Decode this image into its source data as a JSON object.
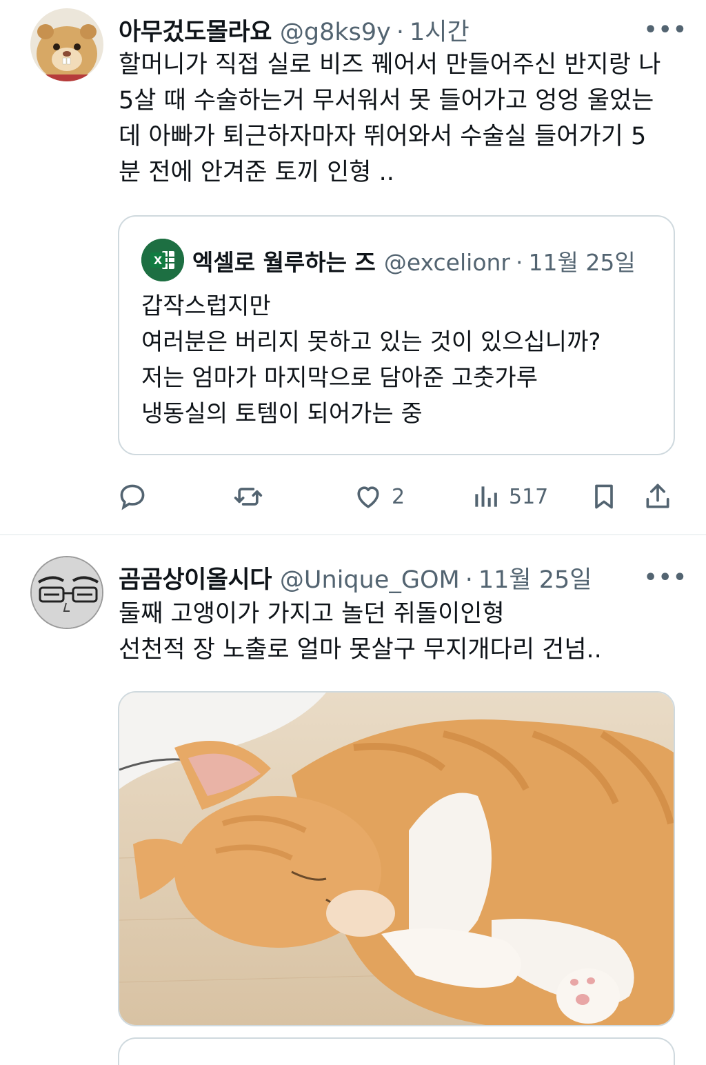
{
  "tweets": [
    {
      "name": "아무겄도몰라요",
      "handle": "@g8ks9y",
      "separator": "·",
      "time": "1시간",
      "more": "•••",
      "text_lines": [
        "할머니가 직접 실로 비즈 꿰어서 만들어주신 반지랑 나",
        "5살 때 수술하는거 무서워서 못 들어가고 엉엉 울었는",
        "데 아빠가 퇴근하자마자 뛰어와서 수술실 들어가기 5",
        "분 전에 안겨준 토끼 인형 .."
      ],
      "quote": {
        "icon_letter": "X",
        "name": "엑셀로 월루하는 즈",
        "handle": "@excelionr",
        "separator": "·",
        "time": "11월 25일",
        "text_lines": [
          "갑작스럽지만",
          "여러분은 버리지 못하고 있는 것이 있으십니까?",
          "저는 엄마가 마지막으로 담아준 고춧가루",
          "냉동실의 토템이 되어가는 중"
        ]
      },
      "actions": {
        "reply_icon": "reply-icon",
        "retweet_icon": "retweet-icon",
        "like_icon": "heart-icon",
        "like_count": "2",
        "views_icon": "views-icon",
        "views_count": "517",
        "bookmark_icon": "bookmark-icon",
        "share_icon": "share-icon"
      }
    },
    {
      "name": "곰곰상이올시다",
      "handle": "@Unique_GOM",
      "separator": "·",
      "time": "11월 25일",
      "more": "•••",
      "text_lines": [
        "둘째 고앵이가 가지고 놀던 쥐돌이인형",
        "선천적 장 노출로 얼마 못살구 무지개다리 건넘.."
      ],
      "media": "sleeping-orange-kitten-photo"
    }
  ],
  "colors": {
    "text": "#0f1419",
    "secondary": "#536471",
    "border": "#cfd9de",
    "excel_green": "#1d6f42"
  }
}
